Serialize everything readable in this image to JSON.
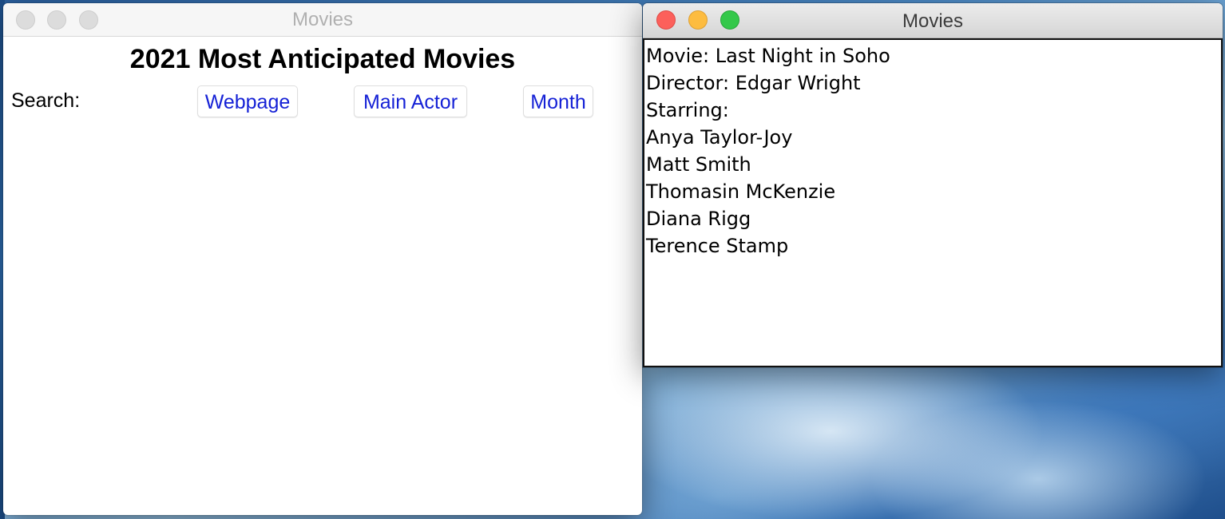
{
  "main_window": {
    "title": "Movies",
    "heading": "2021 Most Anticipated Movies",
    "search_label": "Search:",
    "buttons": {
      "webpage": "Webpage",
      "main_actor": "Main Actor",
      "month": "Month"
    }
  },
  "detail_window": {
    "title": "Movies",
    "movie_line": "Movie: Last Night in Soho",
    "director_line": "Director: Edgar Wright",
    "starring_label": "Starring:",
    "cast": [
      "Anya Taylor-Joy",
      "Matt Smith",
      "Thomasin McKenzie",
      "Diana Rigg",
      "Terence Stamp"
    ]
  },
  "colors": {
    "button_text": "#1521d6",
    "close": "#fc605b",
    "minimize": "#fdbc40",
    "maximize": "#34c84a"
  }
}
